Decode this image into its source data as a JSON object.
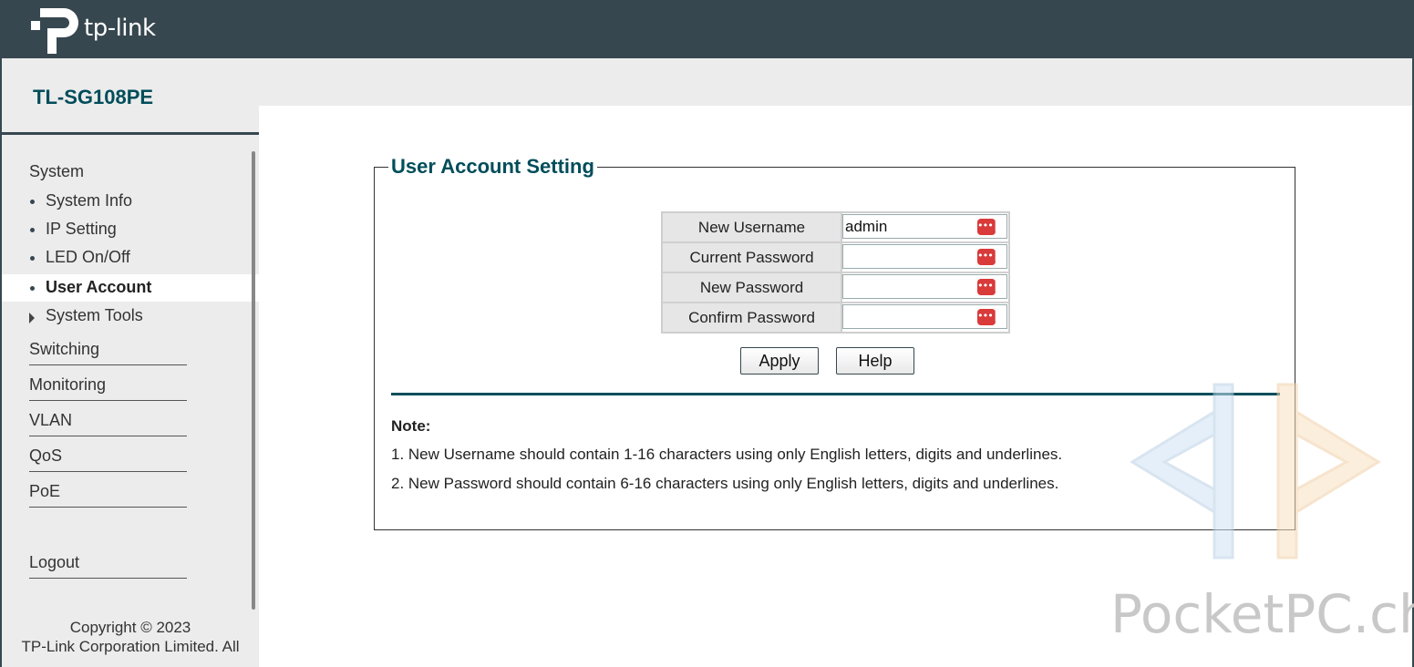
{
  "brand": {
    "logo_text": "tp-link"
  },
  "device": {
    "model": "TL-SG108PE"
  },
  "sidebar": {
    "system_group": "System",
    "system_items": [
      {
        "label": "System Info"
      },
      {
        "label": "IP Setting"
      },
      {
        "label": "LED On/Off"
      },
      {
        "label": "User Account",
        "active": true
      },
      {
        "label": "System Tools"
      }
    ],
    "groups": [
      {
        "label": "Switching"
      },
      {
        "label": "Monitoring"
      },
      {
        "label": "VLAN"
      },
      {
        "label": "QoS"
      },
      {
        "label": "PoE"
      }
    ],
    "logout": "Logout",
    "copyright_1": "Copyright © 2023",
    "copyright_2": "TP-Link Corporation Limited. All"
  },
  "panel": {
    "title": "User Account Setting",
    "fields": [
      {
        "label": "New Username",
        "value": "admin"
      },
      {
        "label": "Current Password",
        "value": ""
      },
      {
        "label": "New Password",
        "value": ""
      },
      {
        "label": "Confirm Password",
        "value": ""
      }
    ],
    "apply_label": "Apply",
    "help_label": "Help",
    "note_title": "Note:",
    "notes": [
      "1. New Username should contain 1-16 characters using only English letters, digits and underlines.",
      "2. New Password should contain 6-16 characters using only English letters, digits and underlines."
    ]
  },
  "watermark": {
    "text": "PocketPC.ch"
  },
  "colors": {
    "header": "#37474f",
    "accent": "#004d5a",
    "sidebar": "#ececec",
    "icon_red": "#d93a3a"
  }
}
